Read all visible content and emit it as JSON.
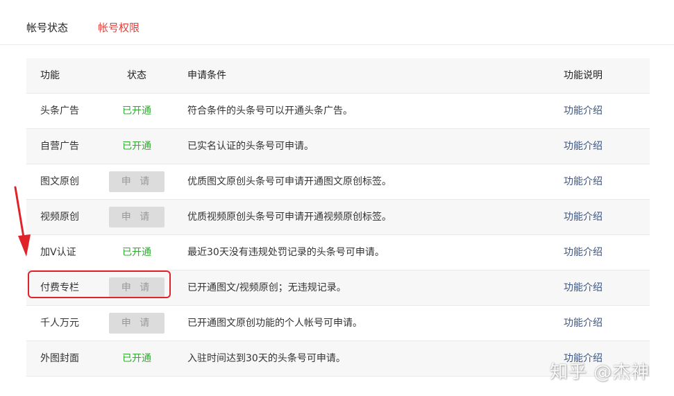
{
  "tabs": [
    {
      "label": "帐号状态"
    },
    {
      "label": "帐号权限"
    }
  ],
  "table": {
    "headers": {
      "name": "功能",
      "status": "状态",
      "condition": "申请条件",
      "description": "功能说明"
    },
    "rows": [
      {
        "name": "头条广告",
        "status": "已开通",
        "condition": "符合条件的头条号可以开通头条广告。",
        "link": "功能介绍"
      },
      {
        "name": "自营广告",
        "status": "已开通",
        "condition": "已实名认证的头条号可申请。",
        "link": "功能介绍"
      },
      {
        "name": "图文原创",
        "status": "申 请",
        "condition": "优质图文原创头条号可申请开通图文原创标签。",
        "link": "功能介绍"
      },
      {
        "name": "视频原创",
        "status": "申 请",
        "condition": "优质视频原创头条号可申请开通视频原创标签。",
        "link": "功能介绍"
      },
      {
        "name": "加V认证",
        "status": "已开通",
        "condition": "最近30天没有违规处罚记录的头条号可申请。",
        "link": "功能介绍"
      },
      {
        "name": "付费专栏",
        "status": "申 请",
        "condition": "已开通图文/视频原创；无违规记录。",
        "link": "功能介绍"
      },
      {
        "name": "千人万元",
        "status": "申 请",
        "condition": "已开通图文原创功能的个人帐号可申请。",
        "link": "功能介绍"
      },
      {
        "name": "外图封面",
        "status": "已开通",
        "condition": "入驻时间达到30天的头条号可申请。",
        "link": "功能介绍"
      }
    ]
  },
  "colors": {
    "active_tab": "#e2403b",
    "status_open": "#2eab2e",
    "link": "#3d5580",
    "annotation": "#e0232a"
  },
  "watermark": "知乎 @杰神"
}
